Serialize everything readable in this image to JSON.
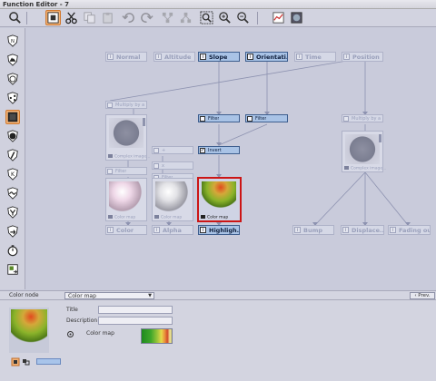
{
  "window": {
    "title": "Function Editor - 7"
  },
  "toolbar": {
    "tools": [
      "search-icon",
      "inspect-icon",
      "cut-icon",
      "copy-icon",
      "paste-icon",
      "undo-icon",
      "redo-icon",
      "group-icon",
      "ungroup-icon",
      "zoom-region-icon",
      "zoom-in-icon",
      "zoom-out-icon",
      "chart-icon",
      "render-icon"
    ]
  },
  "sidebar": {
    "tools": [
      "shield-icon",
      "mountain-icon",
      "globe-icon",
      "share-icon",
      "color-swatch-icon",
      "circle-icon",
      "slash-icon",
      "tool-icon",
      "wave-icon",
      "merge-icon",
      "redirect-icon",
      "timer-icon",
      "export-icon"
    ],
    "active": "color-swatch-icon"
  },
  "graph": {
    "input_nodes": [
      {
        "label": "Normal",
        "active": false
      },
      {
        "label": "Altitude",
        "active": false
      },
      {
        "label": "Slope",
        "active": true
      },
      {
        "label": "Orientati...",
        "active": true
      },
      {
        "label": "Time",
        "active": false
      },
      {
        "label": "Position",
        "active": false
      }
    ],
    "small_nodes": [
      {
        "label": "Multiply by a co...",
        "active": false
      },
      {
        "label": "Filter",
        "active": true
      },
      {
        "label": "Filter",
        "active": true
      },
      {
        "label": "Multiply by a co...",
        "active": false
      }
    ],
    "previews": [
      {
        "caption": "Complex image...",
        "active": false,
        "style": "noise"
      },
      {
        "caption": "Complex image...",
        "active": false,
        "style": "noise"
      }
    ],
    "mid_nodes": [
      {
        "label": "+",
        "active": false
      },
      {
        "label": "x",
        "active": false
      },
      {
        "label": "Invert",
        "active": true
      },
      {
        "label": "Filter",
        "active": false
      },
      {
        "label": "Filter",
        "active": false
      }
    ],
    "material_previews": [
      {
        "caption": "Color map",
        "active": false,
        "style": "pink"
      },
      {
        "caption": "Color map",
        "active": false,
        "style": "grey"
      },
      {
        "caption": "Color map",
        "active": true,
        "style": "colormap"
      }
    ],
    "output_nodes": [
      {
        "label": "Color",
        "active": false
      },
      {
        "label": "Alpha",
        "active": false
      },
      {
        "label": "Highligh...",
        "active": true
      },
      {
        "label": "Bump",
        "active": false
      },
      {
        "label": "Displace...",
        "active": false
      },
      {
        "label": "Fading out",
        "active": false
      }
    ]
  },
  "panel": {
    "header_label": "Color node",
    "selected_type": "Color map",
    "prev_label": "‹ Prev.",
    "title_label": "Title",
    "title_value": "",
    "description_label": "Description",
    "description_value": "",
    "colormap_label": "Color map"
  },
  "colors": {
    "active_tool": "#f2b276",
    "active_node": "#a9c3e6",
    "selection_border": "#cc1515",
    "canvas_bg": "#c9cbdb"
  }
}
